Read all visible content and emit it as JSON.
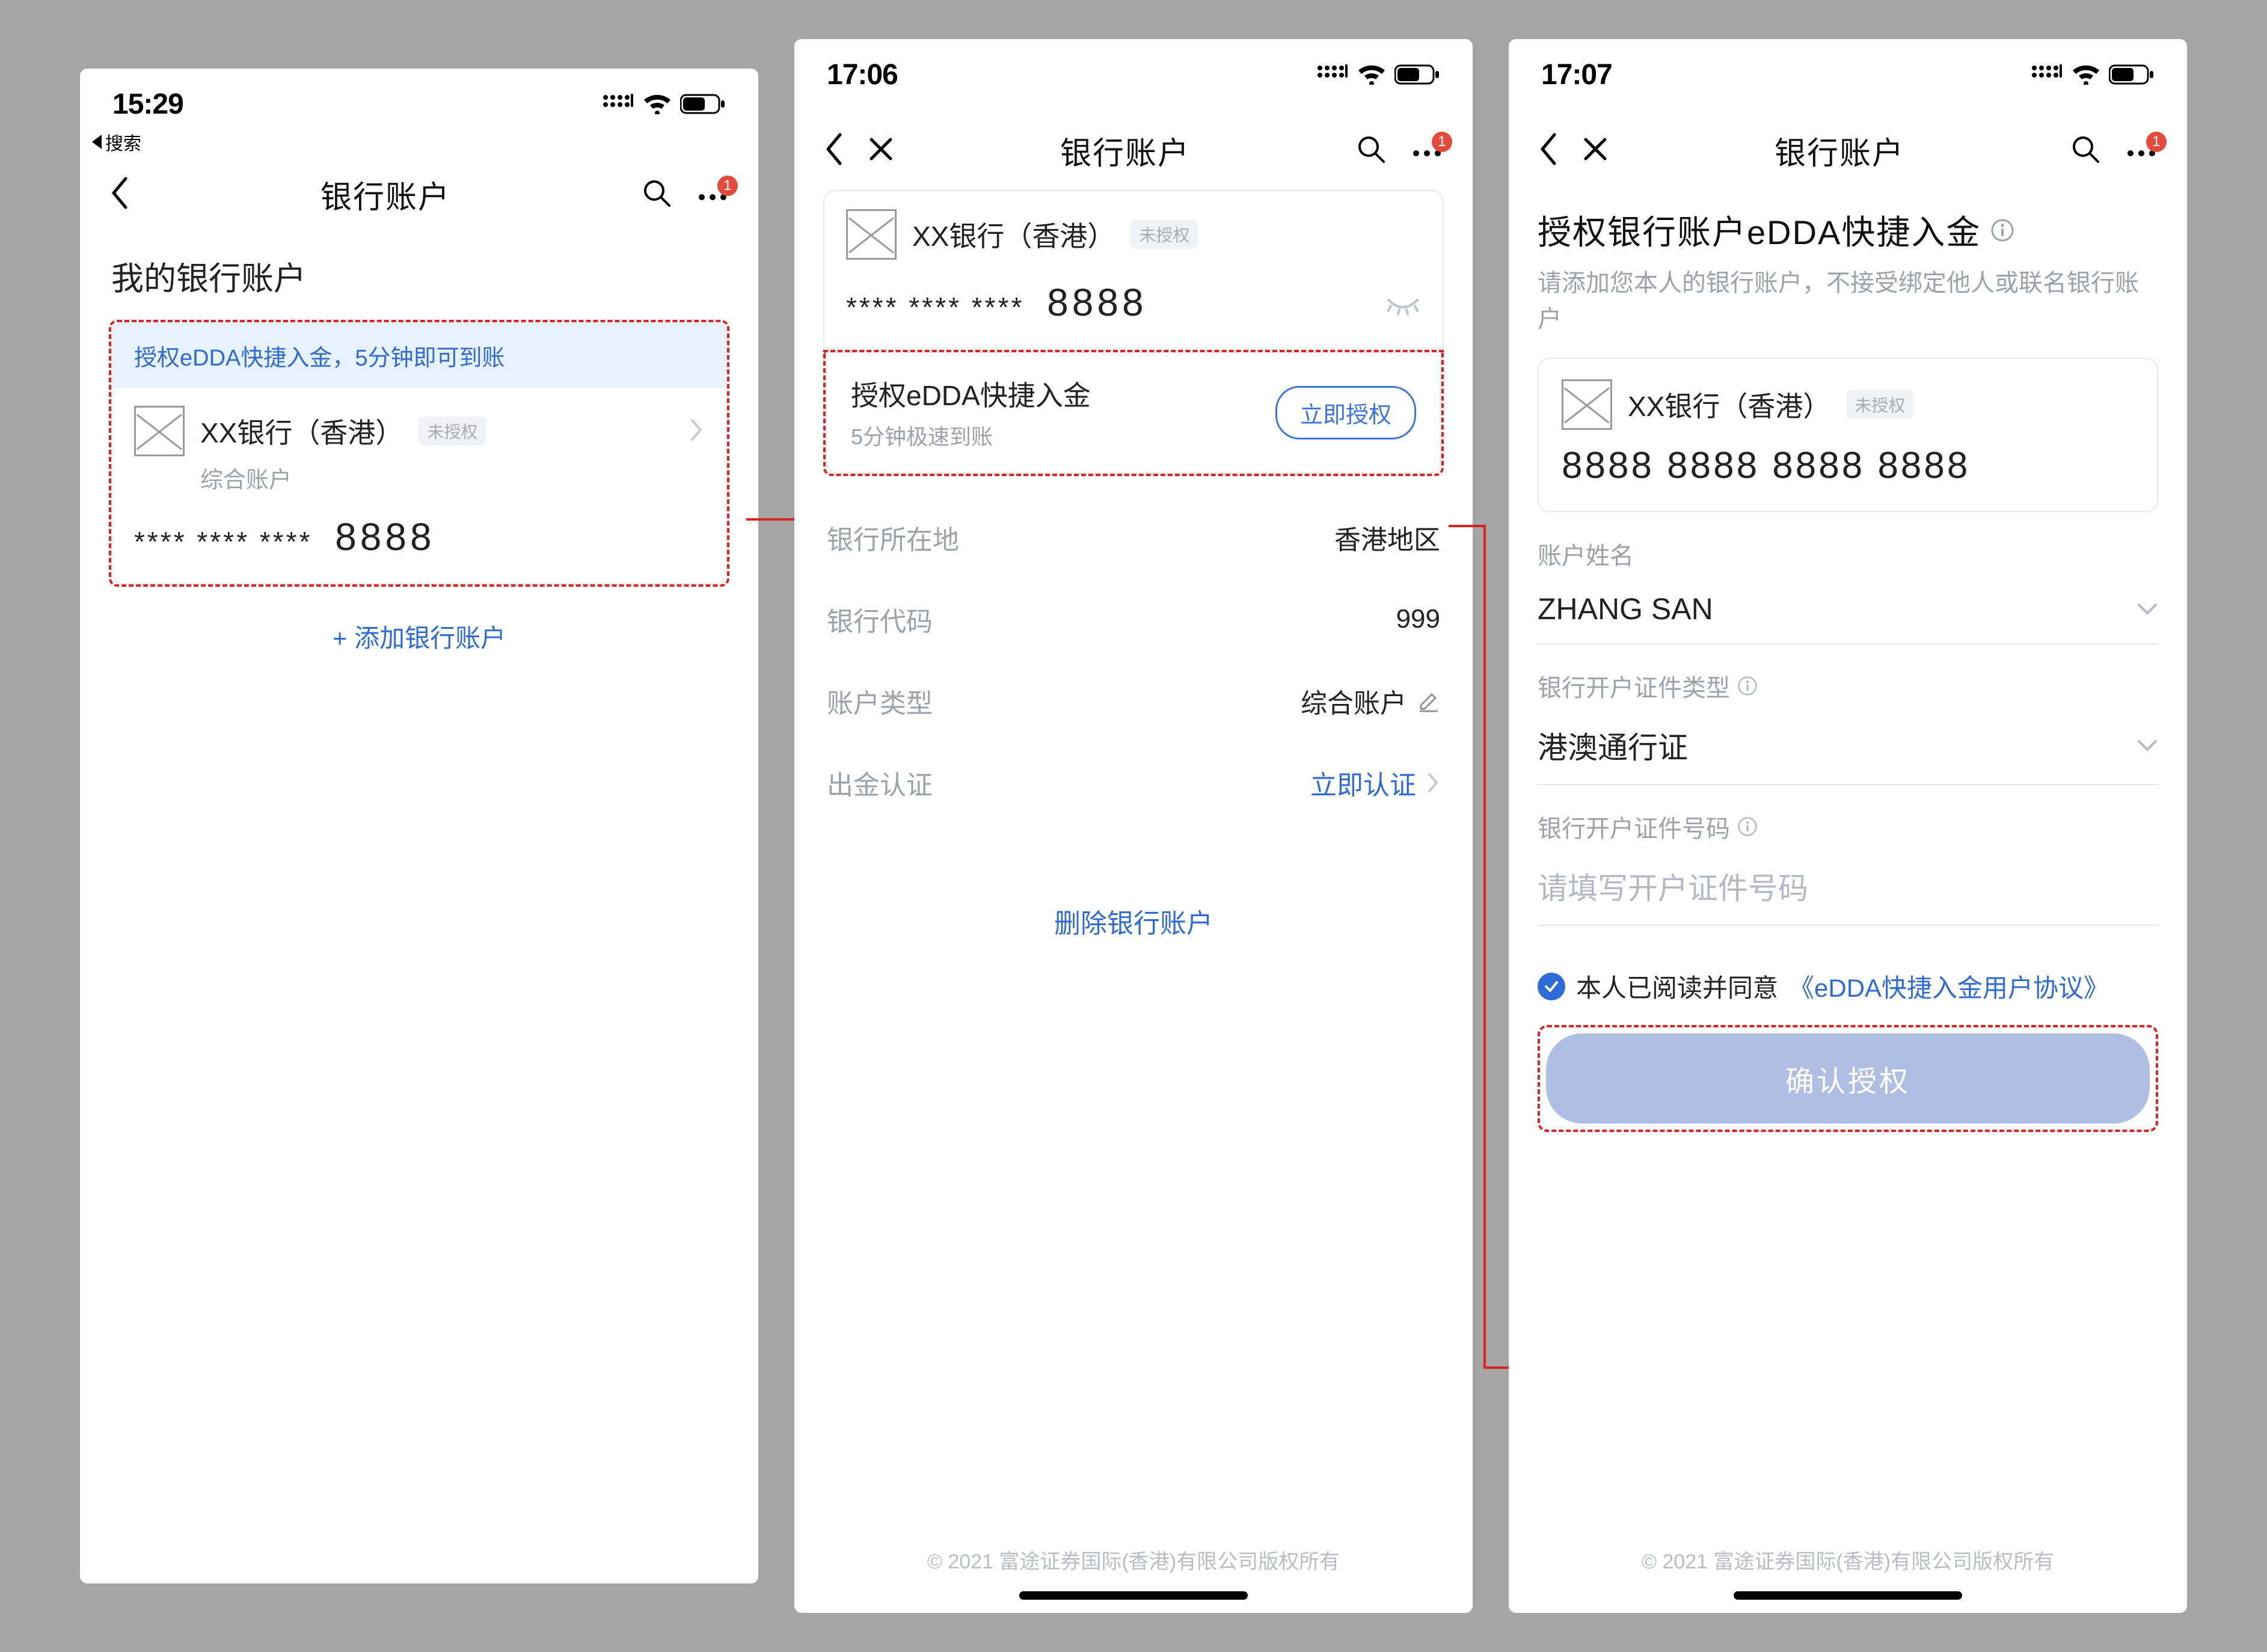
{
  "screens": {
    "s1": {
      "time": "15:29",
      "sub_status": "搜索",
      "nav_title": "银行账户",
      "badge": "1",
      "section_title": "我的银行账户",
      "banner": "授权eDDA快捷入金，5分钟即可到账",
      "bank_name": "XX银行（香港）",
      "tag": "未授权",
      "account_type": "综合账户",
      "masked": "**** **** ****",
      "last4": "8888",
      "add_link": "+ 添加银行账户"
    },
    "s2": {
      "time": "17:06",
      "nav_title": "银行账户",
      "badge": "1",
      "bank_name": "XX银行（香港）",
      "tag": "未授权",
      "masked": "**** **** ****",
      "last4": "8888",
      "auth_title": "授权eDDA快捷入金",
      "auth_sub": "5分钟极速到账",
      "auth_btn": "立即授权",
      "rows": {
        "region_label": "银行所在地",
        "region_value": "香港地区",
        "code_label": "银行代码",
        "code_value": "999",
        "type_label": "账户类型",
        "type_value": "综合账户",
        "verify_label": "出金认证",
        "verify_link": "立即认证"
      },
      "delete_link": "删除银行账户",
      "footer": "© 2021 富途证券国际(香港)有限公司版权所有"
    },
    "s3": {
      "time": "17:07",
      "nav_title": "银行账户",
      "badge": "1",
      "heading": "授权银行账户eDDA快捷入金",
      "desc": "请添加您本人的银行账户，不接受绑定他人或联名银行账户",
      "bank_name": "XX银行（香港）",
      "tag": "未授权",
      "full_number": "8888 8888 8888 8888",
      "name_label": "账户姓名",
      "name_value": "ZHANG SAN",
      "idtype_label": "银行开户证件类型",
      "idtype_value": "港澳通行证",
      "idnum_label": "银行开户证件号码",
      "idnum_placeholder": "请填写开户证件号码",
      "consent_text": "本人已阅读并同意",
      "consent_link": "《eDDA快捷入金用户协议》",
      "confirm_btn": "确认授权",
      "footer": "© 2021 富途证券国际(香港)有限公司版权所有"
    }
  }
}
